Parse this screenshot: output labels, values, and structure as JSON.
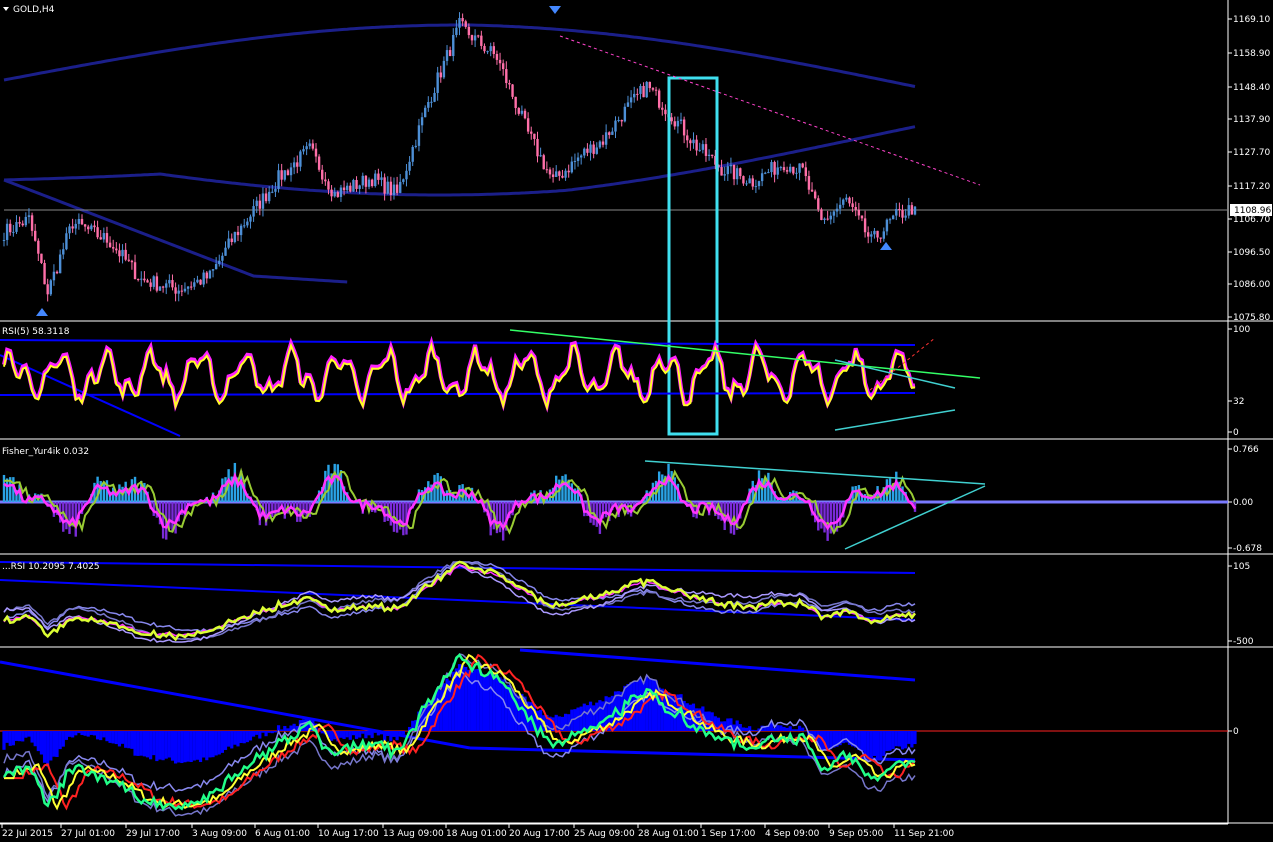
{
  "window": {
    "symbol_label": "GOLD,H4",
    "menu_icon": "triangle-down-icon"
  },
  "colors": {
    "background": "#000000",
    "axis": "#ffffff",
    "bull_candle": "#4d8fd6",
    "bear_candle": "#ff6fa8",
    "envelope": "#1b1f8a",
    "highlight_box": "#3fe0f0",
    "rsi_main": "#ffff22",
    "rsi_signal": "#ff22ff",
    "fisher_hist_pos": "#2aa3e6",
    "fisher_hist_neg": "#7a2bd8",
    "fisher_line": "#ff33ff",
    "fisher_signal": "#99cc33",
    "trend_cyan": "#40d0d0",
    "trend_green": "#33ff66",
    "dashed_pink": "#ff44cc",
    "macd_hist": "#0000ff",
    "zero_line": "#ff2222",
    "current_price_label_bg": "#ffffff",
    "current_price_label_fg": "#000000"
  },
  "chart_data": [
    {
      "type": "candlestick",
      "title": "GOLD,H4",
      "current_price": "1108.96",
      "y_ticks": [
        "1169.10",
        "1158.90",
        "1148.40",
        "1137.90",
        "1127.70",
        "1117.20",
        "1106.70",
        "1096.50",
        "1086.00",
        "1075.80"
      ],
      "x_ticks": [
        "22 Jul 2015",
        "27 Jul 01:00",
        "29 Jul 17:00",
        "3 Aug 09:00",
        "6 Aug 01:00",
        "10 Aug 17:00",
        "13 Aug 09:00",
        "18 Aug 01:00",
        "20 Aug 17:00",
        "25 Aug 09:00",
        "28 Aug 01:00",
        "1 Sep 17:00",
        "4 Sep 09:00",
        "9 Sep 05:00",
        "11 Sep 21:00"
      ],
      "ylim": [
        1075.8,
        1169.1
      ],
      "close_anchors": [
        {
          "i": 0,
          "close": 1101
        },
        {
          "i": 8,
          "close": 1105
        },
        {
          "i": 14,
          "close": 1082
        },
        {
          "i": 22,
          "close": 1104
        },
        {
          "i": 34,
          "close": 1098
        },
        {
          "i": 44,
          "close": 1086
        },
        {
          "i": 56,
          "close": 1083
        },
        {
          "i": 66,
          "close": 1087
        },
        {
          "i": 74,
          "close": 1100
        },
        {
          "i": 88,
          "close": 1118
        },
        {
          "i": 98,
          "close": 1127
        },
        {
          "i": 106,
          "close": 1113
        },
        {
          "i": 118,
          "close": 1118
        },
        {
          "i": 126,
          "close": 1113
        },
        {
          "i": 136,
          "close": 1142
        },
        {
          "i": 146,
          "close": 1166
        },
        {
          "i": 158,
          "close": 1156
        },
        {
          "i": 168,
          "close": 1132
        },
        {
          "i": 176,
          "close": 1117
        },
        {
          "i": 186,
          "close": 1126
        },
        {
          "i": 192,
          "close": 1130
        },
        {
          "i": 198,
          "close": 1138
        },
        {
          "i": 206,
          "close": 1147
        },
        {
          "i": 214,
          "close": 1138
        },
        {
          "i": 222,
          "close": 1128
        },
        {
          "i": 230,
          "close": 1121
        },
        {
          "i": 240,
          "close": 1117
        },
        {
          "i": 250,
          "close": 1123
        },
        {
          "i": 256,
          "close": 1120
        },
        {
          "i": 262,
          "close": 1104
        },
        {
          "i": 270,
          "close": 1111
        },
        {
          "i": 278,
          "close": 1098
        },
        {
          "i": 286,
          "close": 1106
        },
        {
          "i": 292,
          "close": 1109
        }
      ],
      "candle_count": 293
    },
    {
      "type": "line",
      "title": "RSI(5) 58.3118",
      "y_ticks": [
        "100",
        "32",
        "0"
      ],
      "ylim": [
        0,
        100
      ]
    },
    {
      "type": "bar",
      "title": "Fisher_Yur4ik 0.032",
      "y_ticks": [
        "0.766",
        "0.00",
        "-0.678"
      ],
      "ylim": [
        -0.678,
        0.766
      ]
    },
    {
      "type": "line",
      "title": "...RSI 10.2095 7.4025",
      "y_ticks": [
        "105",
        "-500"
      ]
    },
    {
      "type": "bar",
      "title": "",
      "y_ticks": [
        "0"
      ]
    }
  ]
}
